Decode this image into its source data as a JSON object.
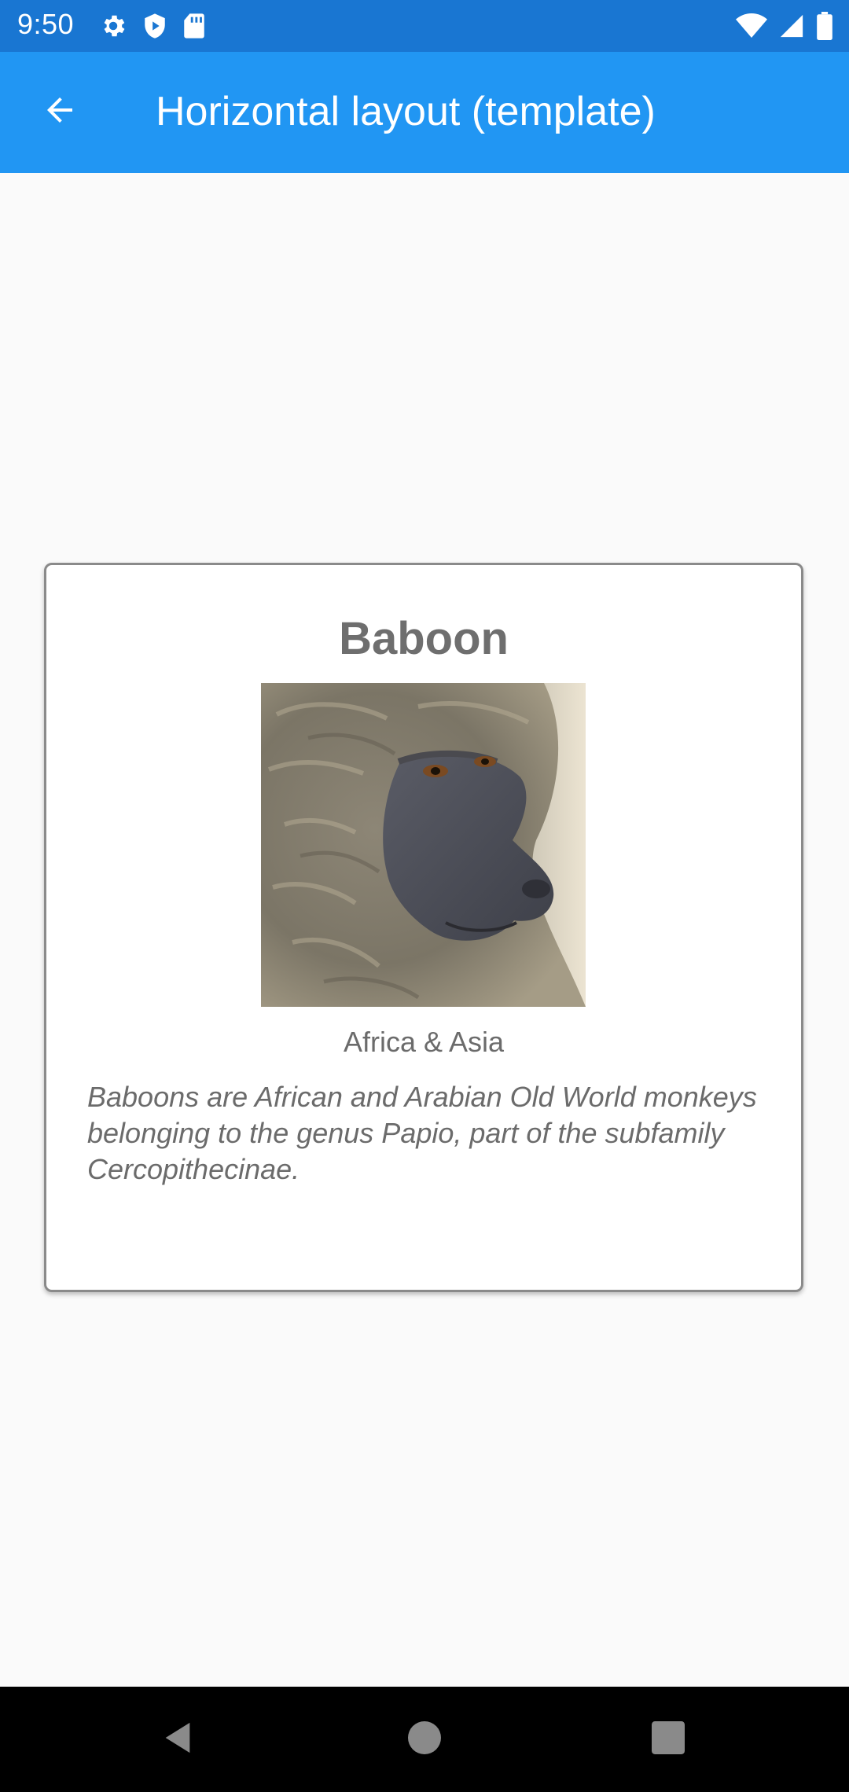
{
  "status_bar": {
    "time": "9:50",
    "left_icons": [
      "gear-icon",
      "shield-play-icon",
      "sd-card-icon"
    ],
    "right_icons": [
      "wifi-icon",
      "signal-icon",
      "battery-icon"
    ]
  },
  "app_bar": {
    "back_icon": "arrow-left-icon",
    "title": "Horizontal layout (template)",
    "background": "#2196f3",
    "status_background": "#1976d2"
  },
  "card": {
    "title": "Baboon",
    "image_alt": "baboon",
    "location": "Africa & Asia",
    "description": "Baboons are African and Arabian Old World monkeys belonging to the genus Papio, part of the subfamily Cercopithecinae."
  },
  "nav_bar": {
    "buttons": [
      "back-triangle-icon",
      "home-circle-icon",
      "recents-square-icon"
    ]
  }
}
